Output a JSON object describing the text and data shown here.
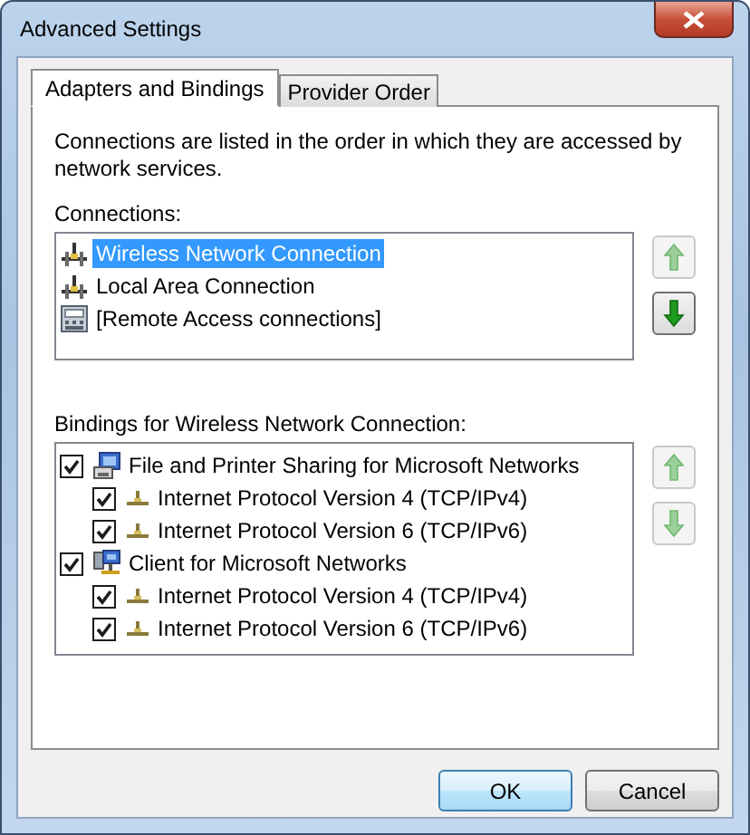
{
  "window": {
    "title": "Advanced Settings"
  },
  "tabs": [
    {
      "label": "Adapters and Bindings",
      "selected": true
    },
    {
      "label": "Provider Order",
      "selected": false
    }
  ],
  "intro": "Connections are listed in the order in which they are accessed by network services.",
  "connections": {
    "label": "Connections:",
    "items": [
      {
        "name": "Wireless Network Connection",
        "kind": "network",
        "selected": true
      },
      {
        "name": "Local Area Connection",
        "kind": "network",
        "selected": false
      },
      {
        "name": "[Remote Access connections]",
        "kind": "remote",
        "selected": false
      }
    ],
    "move_up": {
      "disabled": true
    },
    "move_down": {
      "disabled": false
    }
  },
  "bindings": {
    "label": "Bindings for Wireless Network Connection:",
    "items": [
      {
        "name": "File and Printer Sharing for Microsoft Networks",
        "kind": "service",
        "checked": true,
        "children": [
          {
            "name": "Internet Protocol Version 4 (TCP/IPv4)",
            "kind": "protocol",
            "checked": true
          },
          {
            "name": "Internet Protocol Version 6 (TCP/IPv6)",
            "kind": "protocol",
            "checked": true
          }
        ]
      },
      {
        "name": "Client for Microsoft Networks",
        "kind": "client",
        "checked": true,
        "children": [
          {
            "name": "Internet Protocol Version 4 (TCP/IPv4)",
            "kind": "protocol",
            "checked": true
          },
          {
            "name": "Internet Protocol Version 6 (TCP/IPv6)",
            "kind": "protocol",
            "checked": true
          }
        ]
      }
    ],
    "move_up": {
      "disabled": true
    },
    "move_down": {
      "disabled": true
    }
  },
  "buttons": [
    {
      "label": "OK",
      "kind": "default"
    },
    {
      "label": "Cancel",
      "kind": "normal"
    }
  ]
}
